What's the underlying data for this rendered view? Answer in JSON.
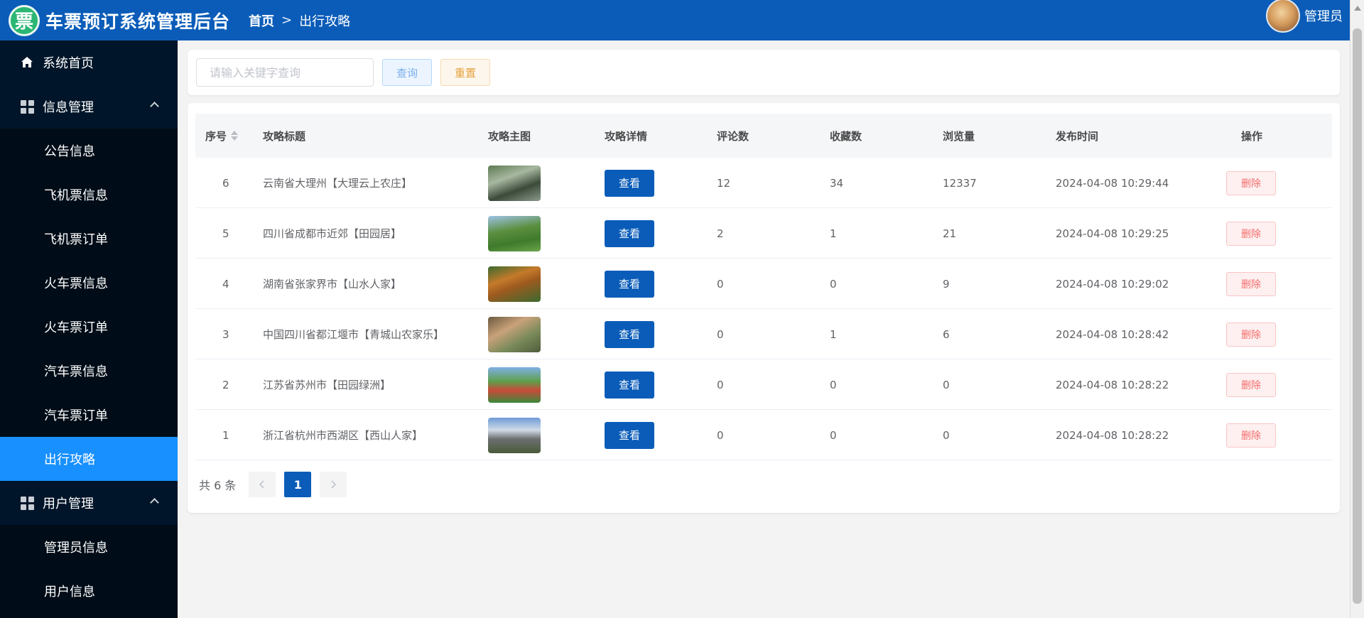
{
  "header": {
    "logo_char": "票",
    "title": "车票预订系统管理后台",
    "breadcrumb": {
      "home": "首页",
      "separator": ">",
      "current": "出行攻略"
    },
    "user_name": "管理员",
    "bg_color": "#0a5cb8"
  },
  "sidebar": {
    "items": [
      {
        "label": "系统首页",
        "type": "top",
        "icon": "home-icon"
      },
      {
        "label": "信息管理",
        "type": "group",
        "icon": "grid-icon"
      },
      {
        "label": "公告信息",
        "type": "sub"
      },
      {
        "label": "飞机票信息",
        "type": "sub"
      },
      {
        "label": "飞机票订单",
        "type": "sub"
      },
      {
        "label": "火车票信息",
        "type": "sub"
      },
      {
        "label": "火车票订单",
        "type": "sub"
      },
      {
        "label": "汽车票信息",
        "type": "sub"
      },
      {
        "label": "汽车票订单",
        "type": "sub"
      },
      {
        "label": "出行攻略",
        "type": "sub",
        "active": true
      },
      {
        "label": "用户管理",
        "type": "group",
        "icon": "grid-icon"
      },
      {
        "label": "管理员信息",
        "type": "sub"
      },
      {
        "label": "用户信息",
        "type": "sub"
      }
    ],
    "active_color": "#1890ff"
  },
  "search": {
    "placeholder": "请输入关键字查询",
    "value": "",
    "query_label": "查询",
    "reset_label": "重置"
  },
  "table": {
    "headers": [
      "序号",
      "攻略标题",
      "攻略主图",
      "攻略详情",
      "评论数",
      "收藏数",
      "浏览量",
      "发布时间",
      "操作"
    ],
    "rows": [
      {
        "id": "6",
        "title": "云南省大理州【大理云上农庄】",
        "view": "查看",
        "comments": "12",
        "favorites": "34",
        "views": "12337",
        "time": "2024-04-08 10:29:44",
        "delete": "删除"
      },
      {
        "id": "5",
        "title": "四川省成都市近郊【田园居】",
        "view": "查看",
        "comments": "2",
        "favorites": "1",
        "views": "21",
        "time": "2024-04-08 10:29:25",
        "delete": "删除"
      },
      {
        "id": "4",
        "title": "湖南省张家界市【山水人家】",
        "view": "查看",
        "comments": "0",
        "favorites": "0",
        "views": "9",
        "time": "2024-04-08 10:29:02",
        "delete": "删除"
      },
      {
        "id": "3",
        "title": "中国四川省都江堰市【青城山农家乐】",
        "view": "查看",
        "comments": "0",
        "favorites": "1",
        "views": "6",
        "time": "2024-04-08 10:28:42",
        "delete": "删除"
      },
      {
        "id": "2",
        "title": "江苏省苏州市【田园绿洲】",
        "view": "查看",
        "comments": "0",
        "favorites": "0",
        "views": "0",
        "time": "2024-04-08 10:28:22",
        "delete": "删除"
      },
      {
        "id": "1",
        "title": "浙江省杭州市西湖区【西山人家】",
        "view": "查看",
        "comments": "0",
        "favorites": "0",
        "views": "0",
        "time": "2024-04-08 10:28:22",
        "delete": "删除"
      }
    ]
  },
  "pagination": {
    "total_text": "共 6 条",
    "current_page": "1",
    "prev_icon": "chevron-left-icon",
    "next_icon": "chevron-right-icon"
  }
}
